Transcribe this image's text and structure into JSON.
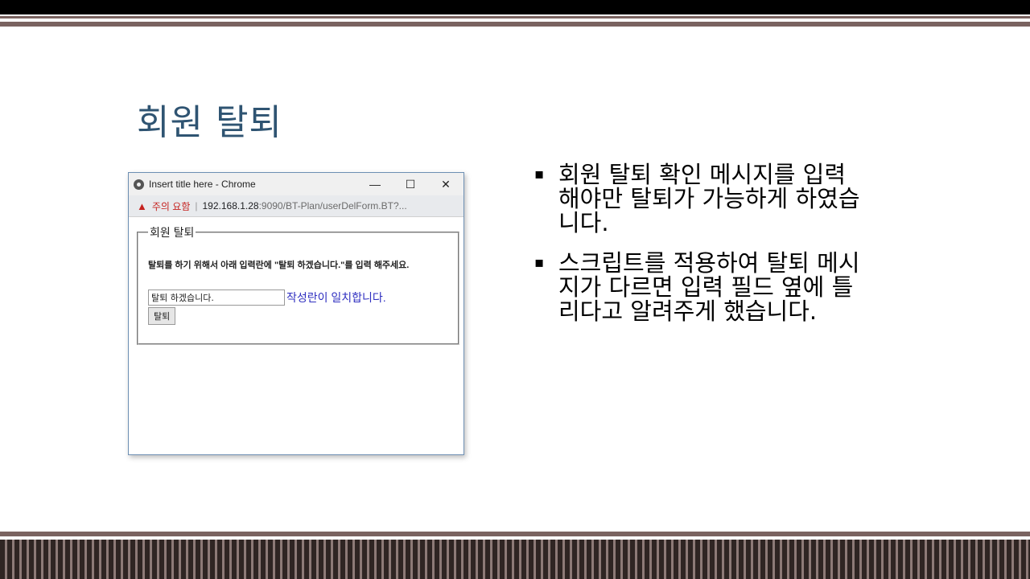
{
  "slide": {
    "title": "회원 탈퇴",
    "bullets": [
      "회원 탈퇴 확인 메시지를 입력 해야만 탈퇴가 가능하게 하였습니다.",
      "스크립트를 적용하여 탈퇴 메시지가 다르면 입력 필드 옆에 틀리다고 알려주게 했습니다."
    ]
  },
  "browser": {
    "window_title": "Insert title here - Chrome",
    "minimize": "—",
    "maximize": "☐",
    "close": "✕",
    "warning_label": "주의 요함",
    "url_host": "192.168.1.28",
    "url_rest": ":9090/BT-Plan/userDelForm.BT?...",
    "form": {
      "legend": "회원 탈퇴",
      "instruction": "탈퇴를 하기 위해서 아래 입력란에 \"탈퇴 하겠습니다.\"를 입력 해주세요.",
      "input_value": "탈퇴 하겠습니다.",
      "match_message": "작성란이 일치합니다.",
      "submit_label": "탈퇴"
    }
  },
  "colors": {
    "title": "#2f5472",
    "accent_brown": "#7a6360",
    "warning": "#c5221f",
    "match_message": "#2f2fc0"
  }
}
